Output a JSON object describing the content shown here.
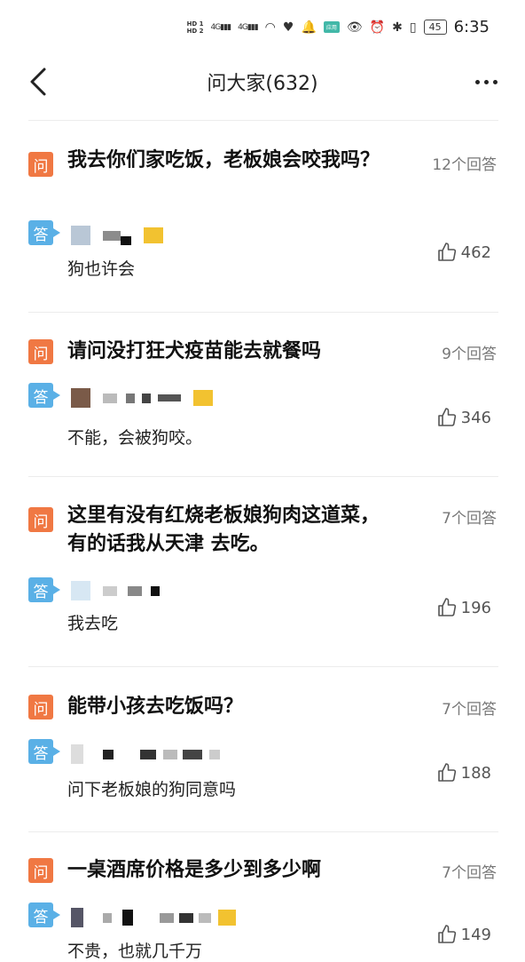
{
  "status_bar": {
    "hd1": "HD 1",
    "hd2": "HD 2",
    "signal1": "4G",
    "signal2": "4G",
    "app_badge": "应用",
    "battery": "45",
    "time": "6:35"
  },
  "nav": {
    "title": "问大家(632)"
  },
  "labels": {
    "question_tag": "问",
    "answer_tag": "答"
  },
  "questions": [
    {
      "question": "我去你们家吃饭，老板娘会咬我吗？",
      "answer_count": "12个回答",
      "answer": "狗也许会",
      "likes": "462"
    },
    {
      "question": "请问没打狂犬疫苗能去就餐吗",
      "answer_count": "9个回答",
      "answer": "不能，会被狗咬。",
      "likes": "346"
    },
    {
      "question": "这里有没有红烧老板娘狗肉这道菜，有的话我从天津 去吃。",
      "answer_count": "7个回答",
      "answer": "我去吃",
      "likes": "196"
    },
    {
      "question": "能带小孩去吃饭吗？",
      "answer_count": "7个回答",
      "answer": "问下老板娘的狗同意吗",
      "likes": "188"
    },
    {
      "question": "一桌酒席价格是多少到多少啊",
      "answer_count": "7个回答",
      "answer": "不贵，也就几千万",
      "likes": "149"
    }
  ],
  "colors": {
    "question_tag": "#f07843",
    "answer_tag": "#5ab0e6"
  }
}
